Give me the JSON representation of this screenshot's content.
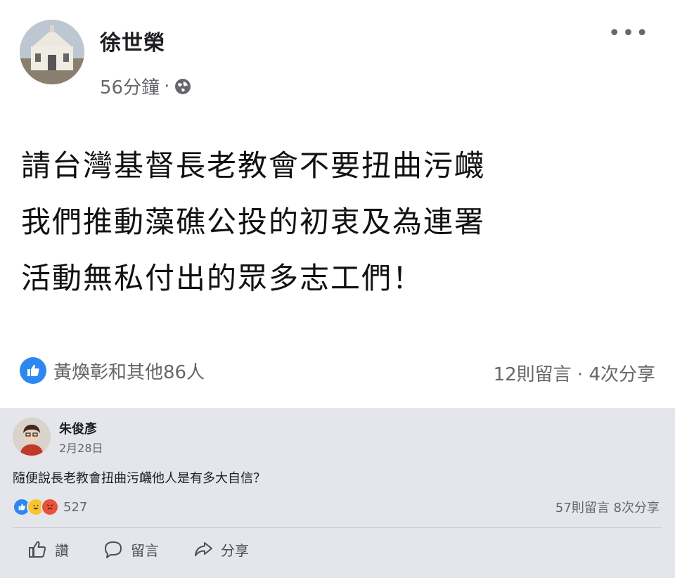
{
  "post": {
    "author": "徐世榮",
    "time": "56分鐘",
    "separator": "·",
    "text": "請台灣基督長老教會不要扭曲污衊\n我們推動藻礁公投的初衷及為連署\n活動無私付出的眾多志工們！",
    "reactions_text": "黃煥彰和其他86人",
    "stats": "12則留言 · 4次分享",
    "icons": {
      "privacy": "globe-icon",
      "more": "more-options-icon",
      "like": "like-icon"
    }
  },
  "shared": {
    "author": "朱俊彥",
    "date": "2月28日",
    "text": "隨便說長老教會扭曲污衊他人是有多大自信？",
    "reaction_count": "527",
    "stats": "57則留言  8次分享",
    "actions": [
      {
        "label": "讚",
        "icon": "thumbs-up-icon"
      },
      {
        "label": "留言",
        "icon": "comment-icon"
      },
      {
        "label": "分享",
        "icon": "share-icon"
      }
    ]
  },
  "colors": {
    "accent": "#2d87f0",
    "muted": "#65676b",
    "shared_bg": "#e4e6eb"
  }
}
